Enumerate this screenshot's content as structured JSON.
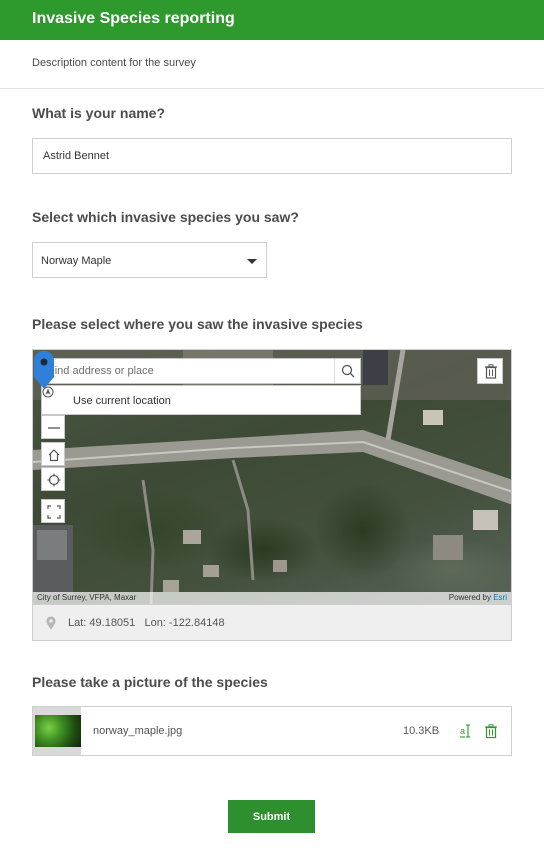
{
  "header": {
    "title": "Invasive Species reporting",
    "color": "#2e9a2e"
  },
  "description": "Description content for the survey",
  "questions": {
    "name": {
      "label": "What is your name?",
      "value": "Astrid Bennet"
    },
    "species": {
      "label": "Select which invasive species you saw?",
      "selected": "Norway Maple"
    },
    "location": {
      "label": "Please select where you saw the invasive species",
      "search_placeholder": "Find address or place",
      "use_current_location": "Use current location",
      "attribution": "City of Surrey, VFPA, Maxar",
      "powered_by": "Powered by",
      "esri": "Esri",
      "coords": "Lat: 49.18051   Lon: -122.84148",
      "icons": [
        "search-icon",
        "trash-icon",
        "zoom-out-icon",
        "home-icon",
        "locate-icon",
        "fullscreen-icon",
        "map-pin-icon"
      ]
    },
    "photo": {
      "label": "Please take a picture of the species",
      "file_name": "norway_maple.jpg",
      "file_size": "10.3KB"
    }
  },
  "submit_label": "Submit",
  "accent_color": "#2e9a2e"
}
